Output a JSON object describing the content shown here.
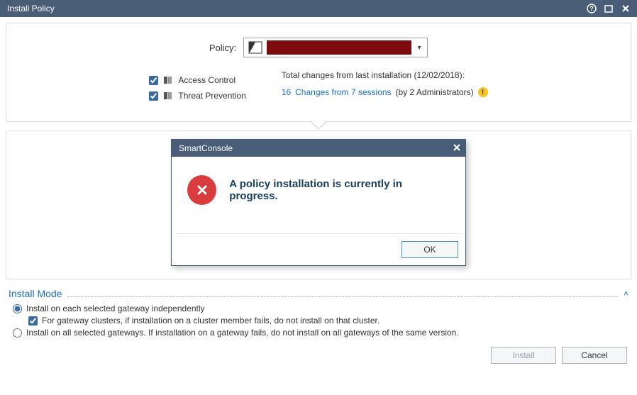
{
  "titlebar": {
    "title": "Install Policy"
  },
  "policy": {
    "label": "Policy:"
  },
  "layers": {
    "access_control": "Access Control",
    "threat_prevention": "Threat Prevention"
  },
  "changes": {
    "headline": "Total changes from last installation (12/02/2018):",
    "count": "16",
    "link": "Changes from 7 sessions",
    "by": "(by 2 Administrators)"
  },
  "install_mode": {
    "title": "Install Mode",
    "opt1": "Install on each selected gateway independently",
    "opt1_sub": "For gateway clusters, if installation on a cluster member fails, do not install on that cluster.",
    "opt2": "Install on all selected gateways. If installation on a gateway fails, do not install on all gateways of the same version."
  },
  "buttons": {
    "install": "Install",
    "cancel": "Cancel"
  },
  "modal": {
    "title": "SmartConsole",
    "message": "A policy installation is currently in progress.",
    "ok": "OK"
  }
}
